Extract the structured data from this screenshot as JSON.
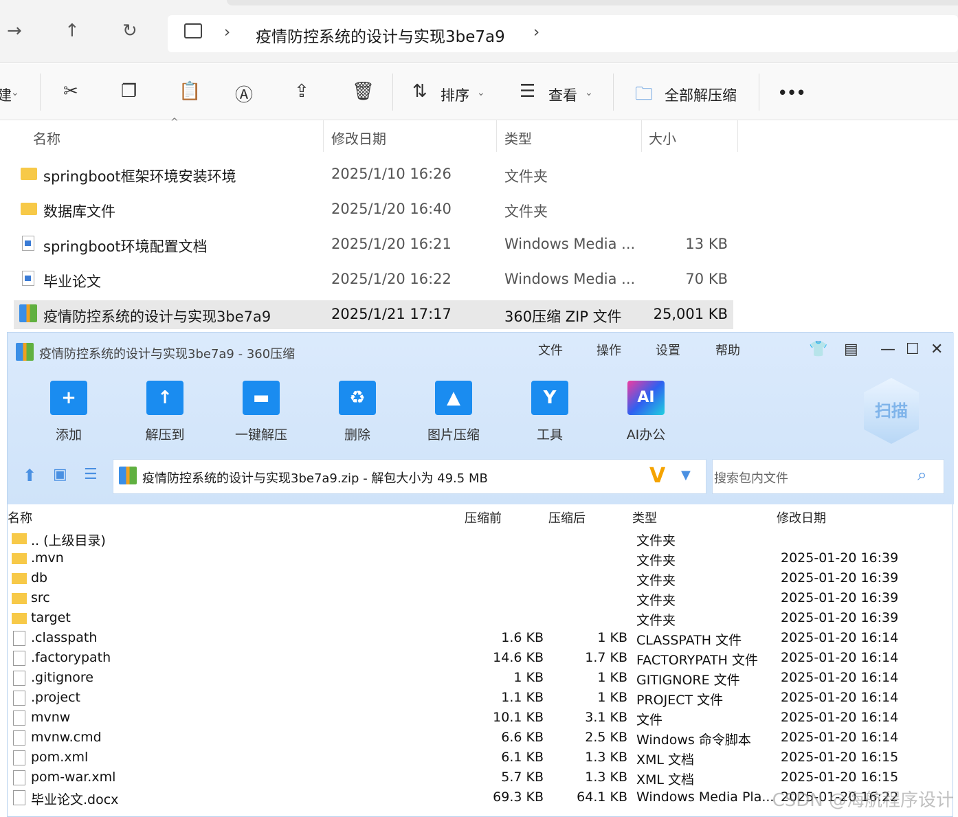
{
  "explorer": {
    "address": {
      "path": "疫情防控系统的设计与实现3be7a9"
    },
    "toolbar": {
      "new_partial": "建",
      "sort": "排序",
      "view": "查看",
      "extract_all": "全部解压缩",
      "more": "•••"
    },
    "columns": [
      "名称",
      "修改日期",
      "类型",
      "大小"
    ],
    "rows": [
      {
        "icon": "folder",
        "name": "springboot框架环境安装环境",
        "date": "2025/1/10 16:26",
        "type": "文件夹",
        "size": ""
      },
      {
        "icon": "folder",
        "name": "数据库文件",
        "date": "2025/1/20 16:40",
        "type": "文件夹",
        "size": ""
      },
      {
        "icon": "doc",
        "name": "springboot环境配置文档",
        "date": "2025/1/20 16:21",
        "type": "Windows Media ...",
        "size": "13 KB"
      },
      {
        "icon": "doc",
        "name": "毕业论文",
        "date": "2025/1/20 16:22",
        "type": "Windows Media ...",
        "size": "70 KB"
      },
      {
        "icon": "zip",
        "name": "疫情防控系统的设计与实现3be7a9",
        "date": "2025/1/21 17:17",
        "type": "360压缩 ZIP 文件",
        "size": "25,001 KB",
        "selected": true
      }
    ]
  },
  "z360": {
    "title": "疫情防控系统的设计与实现3be7a9 - 360压缩",
    "menu": [
      "文件",
      "操作",
      "设置",
      "帮助"
    ],
    "tools": [
      {
        "label": "添加",
        "glyph": "+"
      },
      {
        "label": "解压到",
        "glyph": "↑"
      },
      {
        "label": "一键解压",
        "glyph": "▬"
      },
      {
        "label": "删除",
        "glyph": "♻"
      },
      {
        "label": "图片压缩",
        "glyph": "▲"
      },
      {
        "label": "工具",
        "glyph": "Y"
      },
      {
        "label": "AI办公",
        "glyph": "AI"
      }
    ],
    "scan": "扫描",
    "path": "疫情防控系统的设计与实现3be7a9.zip - 解包大小为 49.5 MB",
    "search_placeholder": "搜索包内文件",
    "columns": [
      "名称",
      "压缩前",
      "压缩后",
      "类型",
      "修改日期"
    ],
    "rows": [
      {
        "icon": "folder",
        "name": ".. (上级目录)",
        "before": "",
        "after": "",
        "type": "文件夹",
        "date": ""
      },
      {
        "icon": "folder",
        "name": ".mvn",
        "before": "",
        "after": "",
        "type": "文件夹",
        "date": "2025-01-20 16:39"
      },
      {
        "icon": "folder",
        "name": "db",
        "before": "",
        "after": "",
        "type": "文件夹",
        "date": "2025-01-20 16:39"
      },
      {
        "icon": "folder",
        "name": "src",
        "before": "",
        "after": "",
        "type": "文件夹",
        "date": "2025-01-20 16:39"
      },
      {
        "icon": "folder",
        "name": "target",
        "before": "",
        "after": "",
        "type": "文件夹",
        "date": "2025-01-20 16:39"
      },
      {
        "icon": "file",
        "name": ".classpath",
        "before": "1.6 KB",
        "after": "1 KB",
        "type": "CLASSPATH 文件",
        "date": "2025-01-20 16:14"
      },
      {
        "icon": "file",
        "name": ".factorypath",
        "before": "14.6 KB",
        "after": "1.7 KB",
        "type": "FACTORYPATH 文件",
        "date": "2025-01-20 16:14"
      },
      {
        "icon": "file",
        "name": ".gitignore",
        "before": "1 KB",
        "after": "1 KB",
        "type": "GITIGNORE 文件",
        "date": "2025-01-20 16:14"
      },
      {
        "icon": "file",
        "name": ".project",
        "before": "1.1 KB",
        "after": "1 KB",
        "type": "PROJECT 文件",
        "date": "2025-01-20 16:14"
      },
      {
        "icon": "file",
        "name": "mvnw",
        "before": "10.1 KB",
        "after": "3.1 KB",
        "type": "文件",
        "date": "2025-01-20 16:14"
      },
      {
        "icon": "file",
        "name": "mvnw.cmd",
        "before": "6.6 KB",
        "after": "2.5 KB",
        "type": "Windows 命令脚本",
        "date": "2025-01-20 16:14"
      },
      {
        "icon": "file",
        "name": "pom.xml",
        "before": "6.1 KB",
        "after": "1.3 KB",
        "type": "XML 文档",
        "date": "2025-01-20 16:15"
      },
      {
        "icon": "file",
        "name": "pom-war.xml",
        "before": "5.7 KB",
        "after": "1.3 KB",
        "type": "XML 文档",
        "date": "2025-01-20 16:15"
      },
      {
        "icon": "file",
        "name": "毕业论文.docx",
        "before": "69.3 KB",
        "after": "64.1 KB",
        "type": "Windows Media Pla...",
        "date": "2025-01-20 16:22"
      }
    ]
  },
  "watermark": "CSDN @海航程序设计"
}
